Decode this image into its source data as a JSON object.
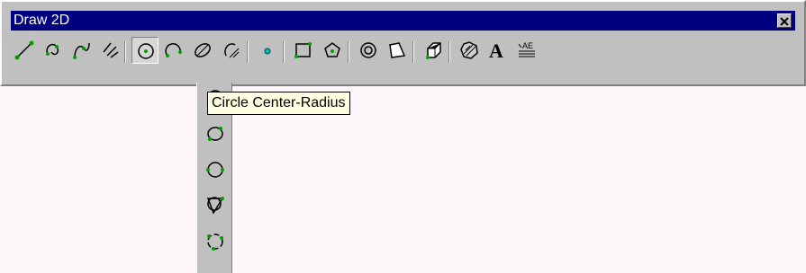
{
  "window": {
    "title": "Draw 2D",
    "close_glyph": "×"
  },
  "toolbar_items": [
    {
      "name": "line-tool",
      "icon": "line-icon"
    },
    {
      "name": "circle-tool",
      "icon": "circle-icon",
      "note": "flyout group (pressed)"
    },
    {
      "name": "arc-tool",
      "icon": "arc-icon"
    },
    {
      "name": "point-tool",
      "icon": "point-icon"
    },
    {
      "name": "rectangle-tool",
      "icon": "rectangle-icon"
    },
    {
      "name": "ring-tool",
      "icon": "ring-icon"
    },
    {
      "name": "solid-tool",
      "icon": "solid-icon"
    },
    {
      "name": "hatch-tool",
      "icon": "hatch-icon"
    },
    {
      "name": "text-tool",
      "icon": "text-icon",
      "glyph": "A"
    },
    {
      "name": "multiline-text-tool",
      "icon": "multiline-text-icon",
      "glyph": "AE"
    }
  ],
  "tooltip": {
    "text": "Circle Center-Radius"
  },
  "flyout_items": [
    {
      "name": "circle-center-radius",
      "icon": "circle-center-radius-icon"
    },
    {
      "name": "circle-center-diameter",
      "icon": "circle-center-diameter-icon"
    },
    {
      "name": "circle-2-point",
      "icon": "circle-2-point-icon"
    },
    {
      "name": "circle-3-point",
      "icon": "circle-3-point-icon"
    },
    {
      "name": "circle-tan-tan-radius",
      "icon": "circle-tan-tan-radius-icon"
    },
    {
      "name": "circle-tan-tan-tan",
      "icon": "circle-tan-tan-tan-icon"
    }
  ],
  "colors": {
    "titlebar": "#000080",
    "face": "#c0c0c0",
    "canvas": "#fdf7fb",
    "tooltip": "#ffffe1",
    "accent": "#00a000"
  }
}
